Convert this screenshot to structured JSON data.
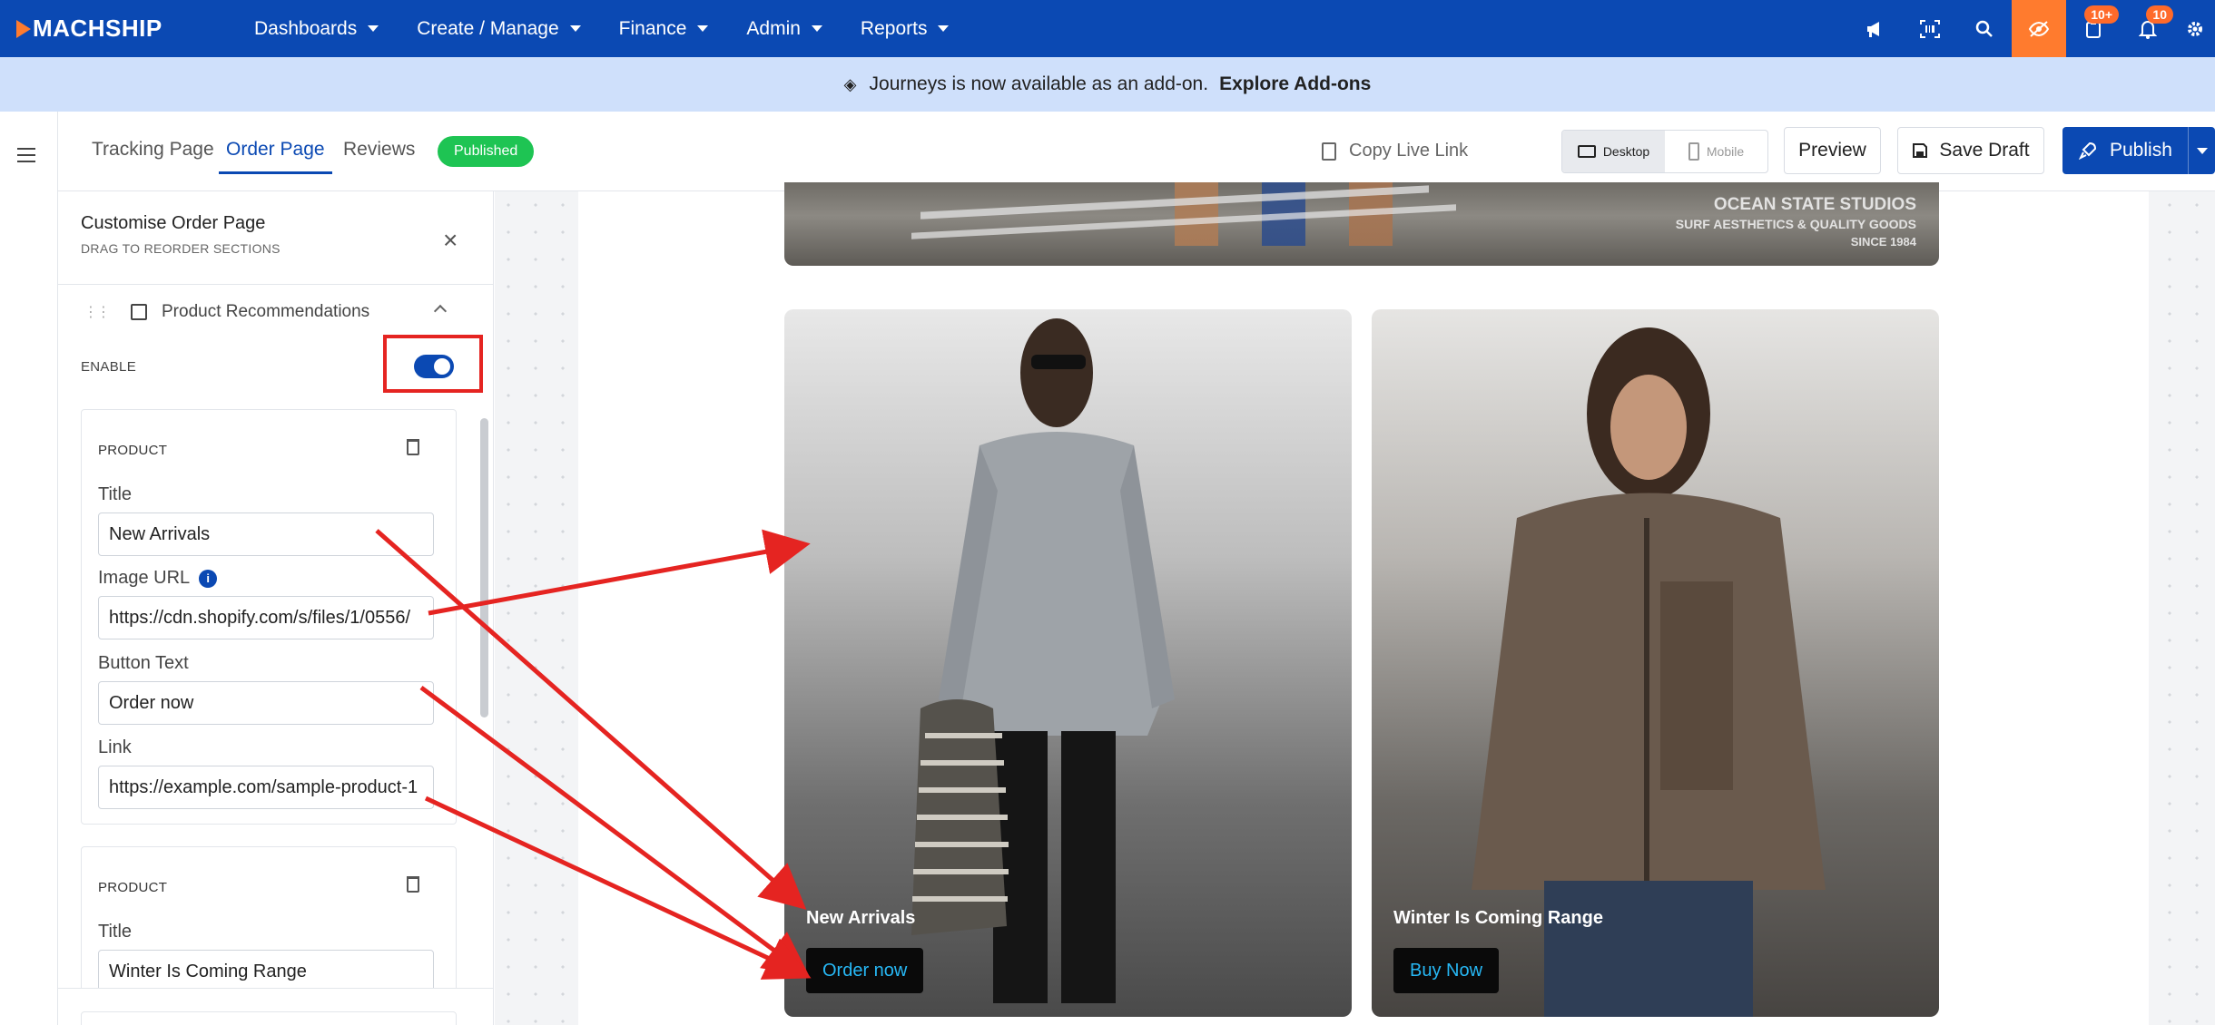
{
  "nav": {
    "logo": "MACHSHIP",
    "items": [
      {
        "label": "Dashboards"
      },
      {
        "label": "Create / Manage"
      },
      {
        "label": "Finance"
      },
      {
        "label": "Admin"
      },
      {
        "label": "Reports"
      }
    ],
    "right_icons": [
      "megaphone-icon",
      "barcode-scan-icon",
      "search-icon",
      "eye-off-icon",
      "tasks-icon",
      "bell-icon",
      "gear-icon"
    ],
    "badges": {
      "tasks": "10+",
      "notifications": "10"
    },
    "accent_color": "#0b49b3",
    "highlight_color": "#ff7b2e"
  },
  "announcement": {
    "text": "Journeys is now available as an add-on.",
    "link": "Explore Add-ons"
  },
  "toolbar": {
    "tabs": [
      {
        "label": "Tracking Page"
      },
      {
        "label": "Order Page"
      },
      {
        "label": "Reviews"
      }
    ],
    "active_tab": "Order Page",
    "status": "Published",
    "copy_link": "Copy Live Link",
    "device_desktop": "Desktop",
    "device_mobile": "Mobile",
    "active_device": "Desktop",
    "preview": "Preview",
    "save_draft": "Save Draft",
    "publish": "Publish"
  },
  "panel": {
    "title": "Customise Order Page",
    "subtitle": "DRAG TO REORDER SECTIONS",
    "section_label": "Product Recommendations",
    "enable_label": "ENABLE",
    "enabled": true,
    "products": [
      {
        "label": "PRODUCT",
        "title_label": "Title",
        "title": "New Arrivals",
        "image_url_label": "Image URL",
        "image_url": "https://cdn.shopify.com/s/files/1/0556/",
        "button_text_label": "Button Text",
        "button_text": "Order now",
        "link_label": "Link",
        "link": "https://example.com/sample-product-1"
      },
      {
        "label": "PRODUCT",
        "title_label": "Title",
        "title": "Winter Is Coming Range"
      }
    ]
  },
  "preview": {
    "hero_text": [
      "OCEAN STATE STUDIOS",
      "SURF AESTHETICS & QUALITY GOODS",
      "SINCE 1984"
    ],
    "cards": [
      {
        "title": "New Arrivals",
        "button": "Order now"
      },
      {
        "title": "Winter Is Coming Range",
        "button": "Buy Now"
      }
    ],
    "button_text_color": "#27b8f5",
    "annotation_color": "#e52421"
  }
}
